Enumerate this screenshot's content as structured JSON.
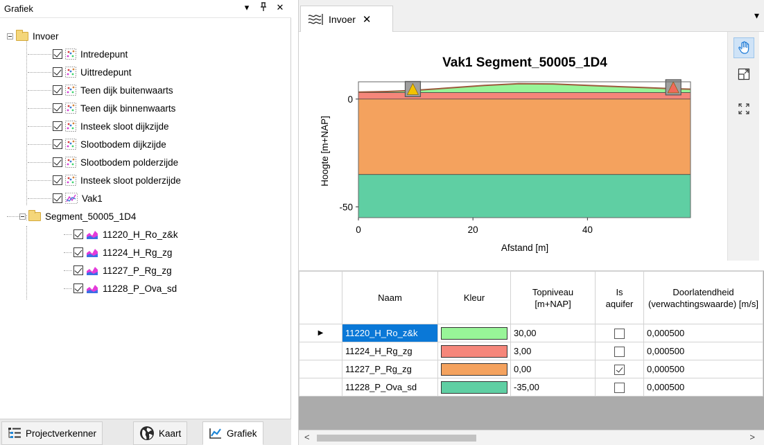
{
  "left_panel": {
    "title": "Grafiek",
    "header_buttons": [
      "▾",
      "ᵖ",
      "✕"
    ],
    "tree": {
      "root": {
        "label": "Invoer",
        "children": [
          {
            "label": "Intredepunt",
            "icon": "point-dots-icon"
          },
          {
            "label": "Uittredepunt",
            "icon": "point-dots-icon"
          },
          {
            "label": "Teen dijk buitenwaarts",
            "icon": "point-dots-icon"
          },
          {
            "label": "Teen dijk binnenwaarts",
            "icon": "point-dots-icon"
          },
          {
            "label": "Insteek sloot dijkzijde",
            "icon": "point-dots-icon"
          },
          {
            "label": "Slootbodem dijkzijde",
            "icon": "point-dots-icon"
          },
          {
            "label": "Slootbodem polderzijde",
            "icon": "point-dots-icon"
          },
          {
            "label": "Insteek sloot polderzijde",
            "icon": "point-dots-icon"
          },
          {
            "label": "Vak1",
            "icon": "line-chart-icon"
          }
        ]
      },
      "segment": {
        "label": "Segment_50005_1D4",
        "children": [
          {
            "label": "11220_H_Ro_z&k",
            "icon": "area-chart-icon"
          },
          {
            "label": "11224_H_Rg_zg",
            "icon": "area-chart-icon"
          },
          {
            "label": "11227_P_Rg_zg",
            "icon": "area-chart-icon"
          },
          {
            "label": "11228_P_Ova_sd",
            "icon": "area-chart-icon"
          }
        ]
      }
    },
    "bottom_tabs": [
      {
        "label": "Projectverkenner",
        "icon": "project-explorer-icon"
      },
      {
        "label": "Kaart",
        "icon": "globe-icon"
      },
      {
        "label": "Grafiek",
        "icon": "line-chart-icon",
        "active": true
      }
    ]
  },
  "right_panel": {
    "tab": {
      "label": "Invoer",
      "close": "✕",
      "icon": "wave-chart-icon"
    },
    "overflow": "▾"
  },
  "chart_data": {
    "type": "area",
    "title": "Vak1 Segment_50005_1D4",
    "xlabel": "Afstand [m]",
    "ylabel": "Hoogte [m+NAP]",
    "xlim": [
      0,
      58
    ],
    "ylim": [
      -55,
      8
    ],
    "xticks": [
      0,
      20,
      40
    ],
    "yticks": [
      0,
      -50
    ],
    "layers": [
      {
        "name": "11220_H_Ro_z&k",
        "top": 3.0,
        "color": "#98f598"
      },
      {
        "name": "11224_H_Rg_zg",
        "top": 3.0,
        "bottom": 0.0,
        "color": "#f5867a"
      },
      {
        "name": "11227_P_Rg_zg",
        "top": 0.0,
        "bottom": -35.0,
        "color": "#f4a25e"
      },
      {
        "name": "11228_P_Ova_sd",
        "top": -35.0,
        "bottom": -55.0,
        "color": "#5fcfa3"
      }
    ],
    "surface_line": {
      "x": [
        0,
        5,
        9.5,
        14,
        22,
        28,
        34,
        42,
        50,
        55,
        58
      ],
      "y": [
        3.2,
        3.5,
        4.0,
        4.8,
        6.3,
        7.1,
        7.0,
        6.1,
        5.3,
        4.8,
        4.6
      ]
    },
    "markers": [
      {
        "x": 9.5,
        "y": 4.0,
        "shape": "triangle",
        "color": "#f2c200"
      },
      {
        "x": 55,
        "y": 4.8,
        "shape": "triangle",
        "color": "#f06a5a"
      }
    ]
  },
  "toolbar": {
    "buttons": [
      {
        "icon": "pan-hand-icon",
        "active": true
      },
      {
        "icon": "zoom-rectangle-icon"
      },
      {
        "icon": "zoom-extent-icon"
      }
    ]
  },
  "grid": {
    "columns": [
      "Naam",
      "Kleur",
      "Topniveau [m+NAP]",
      "Is aquifer",
      "Doorlatendheid (verwachtingswaarde) [m/s]"
    ],
    "rows": [
      {
        "naam": "11220_H_Ro_z&k",
        "kleur": "#98f598",
        "topniveau": "30,00",
        "aquifer": false,
        "doorlatendheid": "0,000500"
      },
      {
        "naam": "11224_H_Rg_zg",
        "kleur": "#f5867a",
        "topniveau": "3,00",
        "aquifer": false,
        "doorlatendheid": "0,000500"
      },
      {
        "naam": "11227_P_Rg_zg",
        "kleur": "#f4a25e",
        "topniveau": "0,00",
        "aquifer": true,
        "doorlatendheid": "0,000500"
      },
      {
        "naam": "11228_P_Ova_sd",
        "kleur": "#5fcfa3",
        "topniveau": "-35,00",
        "aquifer": false,
        "doorlatendheid": "0,000500"
      }
    ],
    "current_row_indicator": "▶"
  }
}
